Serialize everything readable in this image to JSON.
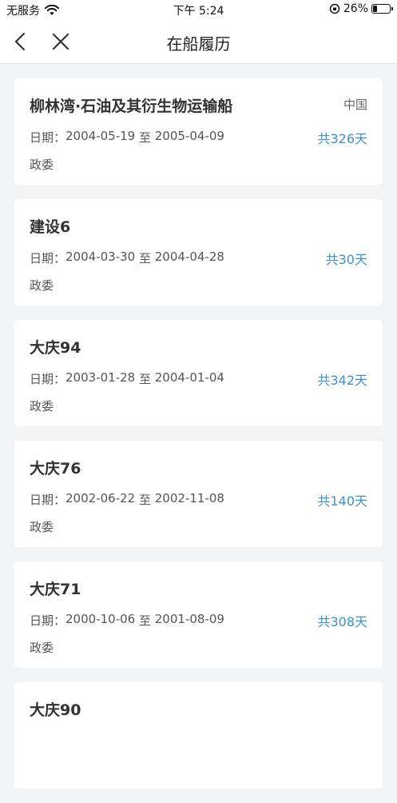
{
  "status_bar": {
    "carrier": "无服务",
    "time": "下午 5:24",
    "battery": "26%",
    "battery_level": 0.26
  },
  "nav": {
    "title": "在船履历"
  },
  "labels": {
    "date_prefix": "日期：",
    "to": " 至 "
  },
  "records": [
    {
      "ship": "柳林湾·石油及其衍生物运输船",
      "country": "中国",
      "start": "2004-05-19",
      "end": "2005-04-09",
      "days": "共326天",
      "position": "政委"
    },
    {
      "ship": "建设6",
      "country": "",
      "start": "2004-03-30",
      "end": "2004-04-28",
      "days": "共30天",
      "position": "政委"
    },
    {
      "ship": "大庆94",
      "country": "",
      "start": "2003-01-28",
      "end": "2004-01-04",
      "days": "共342天",
      "position": "政委"
    },
    {
      "ship": "大庆76",
      "country": "",
      "start": "2002-06-22",
      "end": "2002-11-08",
      "days": "共140天",
      "position": "政委"
    },
    {
      "ship": "大庆71",
      "country": "",
      "start": "2000-10-06",
      "end": "2001-08-09",
      "days": "共308天",
      "position": "政委"
    },
    {
      "ship": "大庆90",
      "country": "",
      "start": "",
      "end": "",
      "days": "",
      "position": ""
    }
  ],
  "colors": {
    "accent": "#3d8fd6",
    "background": "#f2f3f5"
  }
}
